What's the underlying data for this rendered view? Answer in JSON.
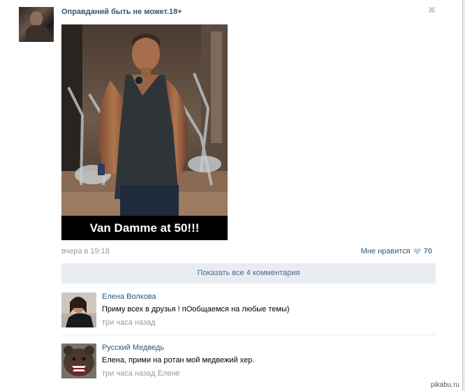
{
  "post": {
    "group_name": "Оправданий быть не может.18+",
    "image_caption": "Van Damme at 50!!!",
    "date": "вчера в 19:18",
    "like_label": "Мне нравится",
    "like_count": "70",
    "close_icon": "✖"
  },
  "comments_toggle": {
    "label": "Показать все 4 комментария"
  },
  "comments": [
    {
      "author": "Елена Волкова",
      "text": "Приму всех в друзья ! пОобщаемся на любые темы)",
      "meta": "три часа назад"
    },
    {
      "author": "Русский Медведь",
      "text": "Елена, прими на ротан мой медвежий хер.",
      "meta": "три часа назад Елене"
    }
  ],
  "watermark": "pikabu.ru",
  "colors": {
    "link": "#2b587a",
    "muted": "#999999",
    "button_bg": "#e9edf1",
    "like_heart": "#c5ced9"
  },
  "icons": [
    "close-icon",
    "heart-icon"
  ]
}
